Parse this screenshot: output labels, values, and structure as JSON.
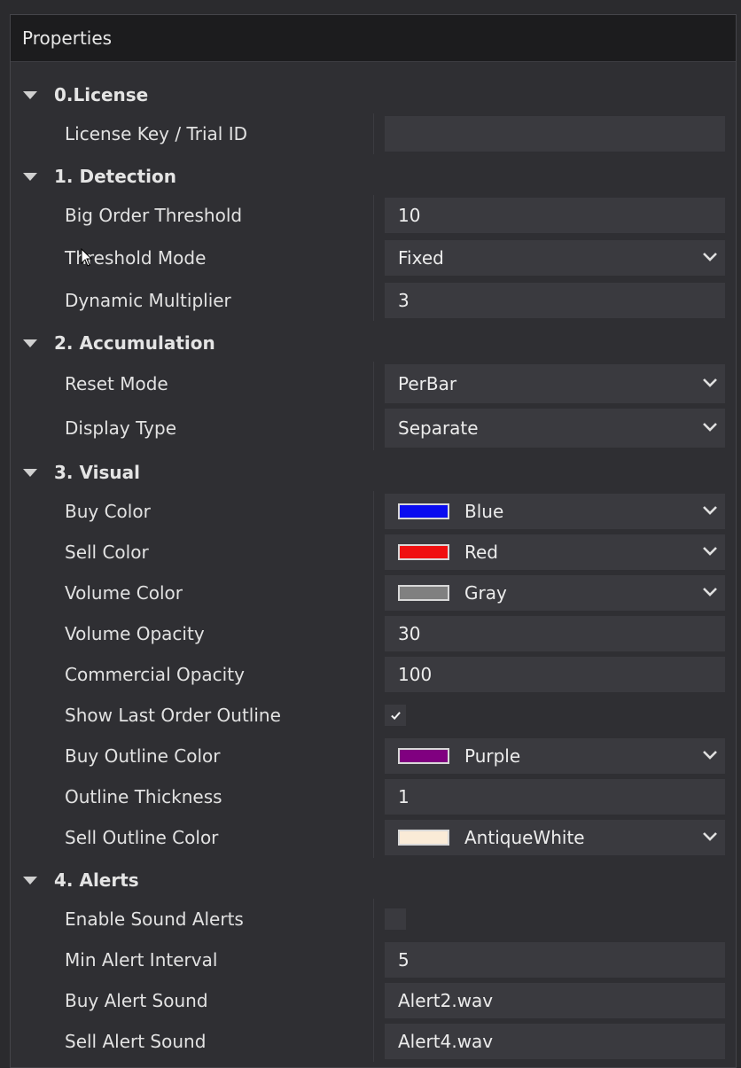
{
  "panel": {
    "title": "Properties"
  },
  "categories": [
    {
      "label": "0.License",
      "properties": [
        {
          "label": "License Key / Trial ID",
          "type": "text",
          "value": ""
        }
      ]
    },
    {
      "label": "1. Detection",
      "properties": [
        {
          "label": "Big Order Threshold",
          "type": "text",
          "value": "10"
        },
        {
          "label": "Threshold Mode",
          "type": "dropdown",
          "value": "Fixed"
        },
        {
          "label": "Dynamic Multiplier",
          "type": "text",
          "value": "3"
        }
      ]
    },
    {
      "label": "2. Accumulation",
      "properties": [
        {
          "label": "Reset Mode",
          "type": "dropdown",
          "value": "PerBar"
        },
        {
          "label": "Display Type",
          "type": "dropdown",
          "value": "Separate"
        }
      ]
    },
    {
      "label": "3. Visual",
      "properties": [
        {
          "label": "Buy Color",
          "type": "color",
          "value": "Blue",
          "swatch": "#0a0cf0"
        },
        {
          "label": "Sell Color",
          "type": "color",
          "value": "Red",
          "swatch": "#f01010"
        },
        {
          "label": "Volume Color",
          "type": "color",
          "value": "Gray",
          "swatch": "#808080"
        },
        {
          "label": "Volume Opacity",
          "type": "text",
          "value": "30"
        },
        {
          "label": "Commercial Opacity",
          "type": "text",
          "value": "100"
        },
        {
          "label": "Show Last Order Outline",
          "type": "checkbox",
          "checked": true
        },
        {
          "label": "Buy Outline Color",
          "type": "color",
          "value": "Purple",
          "swatch": "#800080"
        },
        {
          "label": "Outline Thickness",
          "type": "text",
          "value": "1"
        },
        {
          "label": "Sell Outline Color",
          "type": "color",
          "value": "AntiqueWhite",
          "swatch": "#faebd7"
        }
      ]
    },
    {
      "label": "4. Alerts",
      "properties": [
        {
          "label": "Enable Sound Alerts",
          "type": "checkbox",
          "checked": false
        },
        {
          "label": "Min Alert Interval",
          "type": "text",
          "value": "5"
        },
        {
          "label": "Buy Alert Sound",
          "type": "text",
          "value": "Alert2.wav"
        },
        {
          "label": "Sell Alert Sound",
          "type": "text",
          "value": "Alert4.wav"
        }
      ]
    }
  ],
  "icons": {
    "category_toggle": "triangle-down-icon",
    "dropdown": "chevron-down-icon",
    "check": "checkmark-icon",
    "cursor": "mouse-pointer-icon"
  }
}
